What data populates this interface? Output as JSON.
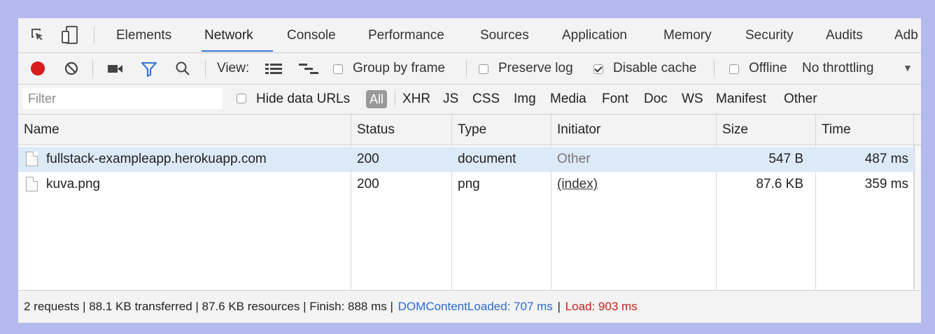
{
  "tabs": [
    {
      "label": "Elements"
    },
    {
      "label": "Network"
    },
    {
      "label": "Console"
    },
    {
      "label": "Performance"
    },
    {
      "label": "Sources"
    },
    {
      "label": "Application"
    },
    {
      "label": "Memory"
    },
    {
      "label": "Security"
    },
    {
      "label": "Audits"
    },
    {
      "label": "Adb"
    }
  ],
  "active_tab": "Network",
  "toolbar": {
    "view_label": "View:",
    "group_by_frame": {
      "label": "Group by frame",
      "checked": false
    },
    "preserve_log": {
      "label": "Preserve log",
      "checked": false
    },
    "disable_cache": {
      "label": "Disable cache",
      "checked": true
    },
    "offline": {
      "label": "Offline",
      "checked": false
    },
    "throttling": "No throttling",
    "throttling_arrow": "▼"
  },
  "filter": {
    "placeholder": "Filter",
    "hide_data_urls": {
      "label": "Hide data URLs",
      "checked": false
    },
    "types": [
      "All",
      "XHR",
      "JS",
      "CSS",
      "Img",
      "Media",
      "Font",
      "Doc",
      "WS",
      "Manifest",
      "Other"
    ]
  },
  "columns": [
    "Name",
    "Status",
    "Type",
    "Initiator",
    "Size",
    "Time"
  ],
  "rows": [
    {
      "name": "fullstack-exampleapp.herokuapp.com",
      "status": "200",
      "type": "document",
      "initiator": "Other",
      "size": "547 B",
      "time": "487 ms"
    },
    {
      "name": "kuva.png",
      "status": "200",
      "type": "png",
      "initiator": "(index)",
      "size": "87.6 KB",
      "time": "359 ms"
    }
  ],
  "status": {
    "summary": "2 requests | 88.1 KB transferred | 87.6 KB resources | Finish: 888 ms |",
    "dom_content_loaded": "DOMContentLoaded: 707 ms",
    "separator": "|",
    "load": "Load: 903 ms"
  },
  "colors": {
    "dom_content_loaded": "#2a6bd6",
    "load": "#c1231b",
    "record": "#d91c1c",
    "active_tab_underline": "#3879d9",
    "filter_icon": "#3879d9"
  },
  "icons": [
    "inspect-icon",
    "device-toolbar-icon",
    "record-icon",
    "clear-icon",
    "capture-screenshots-icon",
    "filter-icon",
    "search-icon",
    "large-rows-icon",
    "waterfall-icon"
  ]
}
